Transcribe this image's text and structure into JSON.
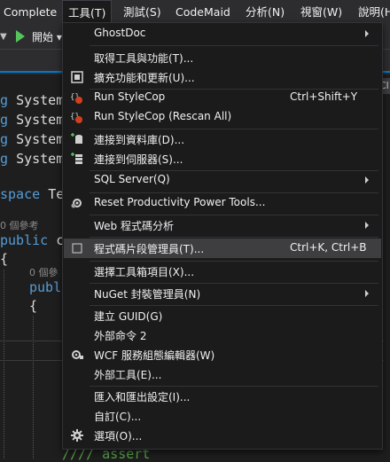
{
  "menubar": {
    "items": [
      "Complete",
      "工具(T)",
      "測試(S)",
      "CodeMaid",
      "分析(N)",
      "視窗(W)",
      "說明(H"
    ]
  },
  "toolbar": {
    "start_label": "開始",
    "dropdown_arrow": "▾"
  },
  "tab_fragment": "Cl",
  "editor": {
    "code_lines": [
      {
        "prefix": "g ",
        "ident": "System"
      },
      {
        "prefix": "g ",
        "ident": "System"
      },
      {
        "prefix": "g ",
        "ident": "System"
      },
      {
        "prefix": "g ",
        "ident": "System"
      }
    ],
    "namespace_kw": "space",
    "namespace_name": "Te",
    "lens_refs_1": "0 個參考",
    "public_kw": "public",
    "public_rest": "c",
    "brace_open": "{",
    "lens_refs_2": "0 個參",
    "public_kw_2": "publ",
    "brace_open_2": "{",
    "comment_bottom": "//// assert"
  },
  "menu": {
    "title": "工具(T)",
    "items": [
      {
        "label": "GhostDoc",
        "shortcut": "",
        "submenu": true,
        "icon": ""
      },
      {
        "label": "取得工具與功能(T)...",
        "shortcut": "",
        "submenu": false,
        "icon": ""
      },
      {
        "label": "擴充功能和更新(U)...",
        "shortcut": "",
        "submenu": false,
        "icon": "extensions-icon"
      },
      {
        "label": "Run StyleCop",
        "shortcut": "Ctrl+Shift+Y",
        "submenu": false,
        "icon": "stylecop-icon"
      },
      {
        "label": "Run StyleCop (Rescan All)",
        "shortcut": "",
        "submenu": false,
        "icon": "stylecop-icon"
      },
      {
        "label": "連接到資料庫(D)...",
        "shortcut": "",
        "submenu": false,
        "icon": "database-connect-icon"
      },
      {
        "label": "連接到伺服器(S)...",
        "shortcut": "",
        "submenu": false,
        "icon": "server-connect-icon"
      },
      {
        "label": "SQL Server(Q)",
        "shortcut": "",
        "submenu": true,
        "icon": ""
      },
      {
        "label": "Reset Productivity Power Tools...",
        "shortcut": "",
        "submenu": false,
        "icon": "power-tools-icon"
      },
      {
        "label": "Web 程式碼分析",
        "shortcut": "",
        "submenu": true,
        "icon": ""
      },
      {
        "label": "程式碼片段管理員(T)...",
        "shortcut": "Ctrl+K, Ctrl+B",
        "submenu": false,
        "icon": "snippet-checkbox-icon"
      },
      {
        "label": "選擇工具箱項目(X)...",
        "shortcut": "",
        "submenu": false,
        "icon": ""
      },
      {
        "label": "NuGet 封裝管理員(N)",
        "shortcut": "",
        "submenu": true,
        "icon": ""
      },
      {
        "label": "建立 GUID(G)",
        "shortcut": "",
        "submenu": false,
        "icon": ""
      },
      {
        "label": "外部命令 2",
        "shortcut": "",
        "submenu": false,
        "icon": ""
      },
      {
        "label": "WCF 服務組態編輯器(W)",
        "shortcut": "",
        "submenu": false,
        "icon": "wcf-config-icon"
      },
      {
        "label": "外部工具(E)...",
        "shortcut": "",
        "submenu": false,
        "icon": ""
      },
      {
        "label": "匯入和匯出設定(I)...",
        "shortcut": "",
        "submenu": false,
        "icon": ""
      },
      {
        "label": "自訂(C)...",
        "shortcut": "",
        "submenu": false,
        "icon": ""
      },
      {
        "label": "選項(O)...",
        "shortcut": "",
        "submenu": false,
        "icon": "gear-icon"
      }
    ]
  }
}
